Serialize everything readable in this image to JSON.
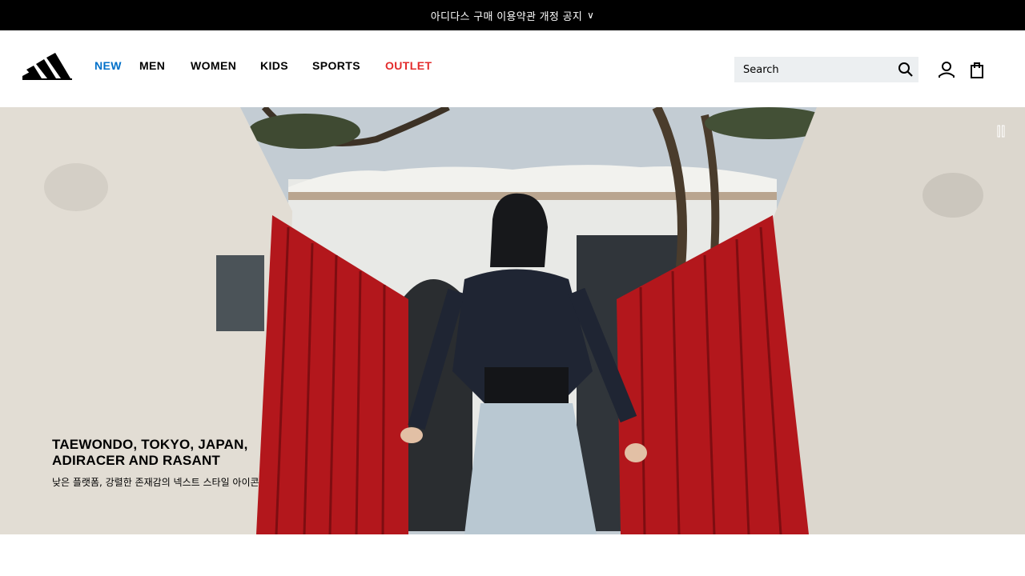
{
  "announcement": {
    "text": "아디다스 구매 이용약관 개정 공지",
    "chevron": "∨"
  },
  "header": {
    "logo": "adidas-logo",
    "nav": [
      {
        "label": "NEW",
        "color": "#0070c9"
      },
      {
        "label": "MEN",
        "color": "#000000"
      },
      {
        "label": "WOMEN",
        "color": "#000000"
      },
      {
        "label": "KIDS",
        "color": "#000000"
      },
      {
        "label": "SPORTS",
        "color": "#000000"
      },
      {
        "label": "OUTLET",
        "color": "#e32b2b"
      }
    ],
    "search": {
      "placeholder": "Search",
      "icon": "search-icon"
    },
    "icons": [
      "account-icon",
      "shopping-bag-icon"
    ]
  },
  "hero": {
    "title_line1": "TAEWONDO, TOKYO, JAPAN,",
    "title_line2": "ADIRACER AND RASANT",
    "subtitle": "낮은 플랫폼, 강렬한 존재감의 넥스트 스타일 아이콘",
    "pause_icon": "pause-icon"
  },
  "colors": {
    "accent_new": "#0070c9",
    "outlet_red": "#e32b2b",
    "gate_red": "#b3171c",
    "bar_black": "#000000"
  }
}
